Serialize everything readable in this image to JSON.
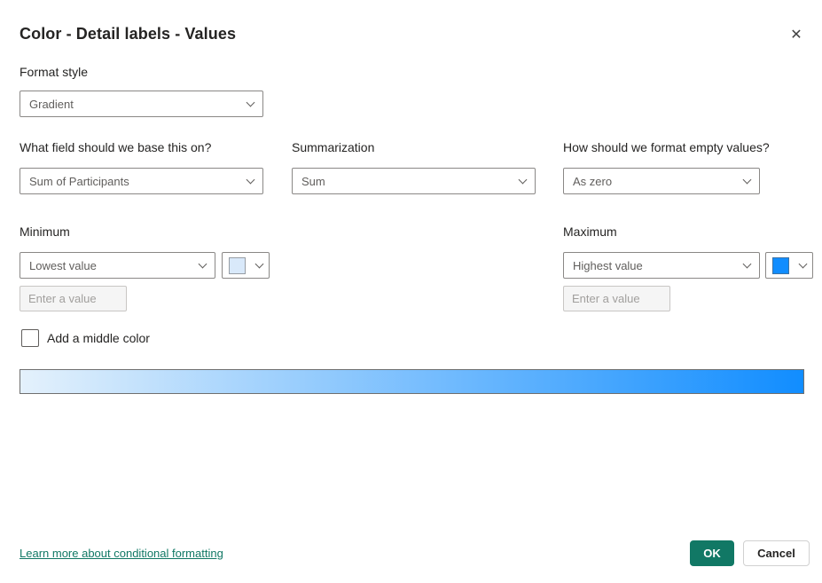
{
  "dialog": {
    "title": "Color - Detail labels - Values"
  },
  "icons": {
    "close": "✕"
  },
  "format_style": {
    "label": "Format style",
    "value": "Gradient"
  },
  "base_field": {
    "label": "What field should we base this on?",
    "value": "Sum of Participants"
  },
  "summarization": {
    "label": "Summarization",
    "value": "Sum"
  },
  "empty_values": {
    "label": "How should we format empty values?",
    "value": "As zero"
  },
  "minimum": {
    "label": "Minimum",
    "value": "Lowest value",
    "swatch_color": "#D9E9FA",
    "input_placeholder": "Enter a value"
  },
  "maximum": {
    "label": "Maximum",
    "value": "Highest value",
    "swatch_color": "#118DFF",
    "input_placeholder": "Enter a value"
  },
  "middle_color": {
    "label": "Add a middle color",
    "checked": false
  },
  "gradient_bar": {
    "start_color": "#E4F1FC",
    "end_color": "#118DFF"
  },
  "footer": {
    "link_label": "Learn more about conditional formatting",
    "ok_label": "OK",
    "cancel_label": "Cancel"
  }
}
